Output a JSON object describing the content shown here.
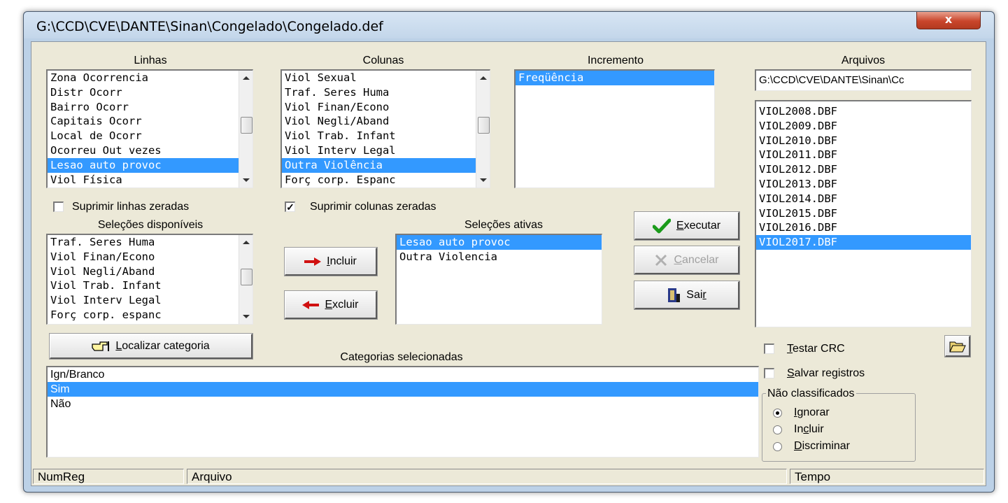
{
  "window": {
    "title": "G:\\CCD\\CVE\\DANTE\\Sinan\\Congelado\\Congelado.def",
    "close_label": "x"
  },
  "linhas": {
    "label": "Linhas",
    "items": [
      "Zona Ocorrencia",
      "Distr Ocorr",
      "Bairro Ocorr",
      "Capitais Ocorr",
      "Local de Ocorr",
      "Ocorreu Out vezes",
      "Lesao auto provoc",
      "Viol Física"
    ],
    "selected": "Lesao auto provoc"
  },
  "colunas": {
    "label": "Colunas",
    "items": [
      "Viol Sexual",
      "Traf. Seres Huma",
      "Viol Finan/Econo",
      "Viol Negli/Aband",
      "Viol Trab. Infant",
      "Viol Interv Legal",
      "Outra Violência",
      "Forç corp. Espanc"
    ],
    "selected": "Outra Violência"
  },
  "incremento": {
    "label": "Incremento",
    "items": [
      "Freqüência"
    ],
    "selected": "Freqüência"
  },
  "arquivos": {
    "label": "Arquivos",
    "path": "G:\\CCD\\CVE\\DANTE\\Sinan\\Cc",
    "items": [
      "VIOL2008.DBF",
      "VIOL2009.DBF",
      "VIOL2010.DBF",
      "VIOL2011.DBF",
      "VIOL2012.DBF",
      "VIOL2013.DBF",
      "VIOL2014.DBF",
      "VIOL2015.DBF",
      "VIOL2016.DBF",
      "VIOL2017.DBF"
    ],
    "selected": "VIOL2017.DBF"
  },
  "options": {
    "suprimir_linhas": {
      "label": "Suprimir linhas zeradas",
      "checked": false
    },
    "suprimir_colunas": {
      "label": "Suprimir colunas zeradas",
      "checked": true,
      "mark": "✓"
    }
  },
  "selecoes_disponiveis": {
    "label": "Seleções disponíveis",
    "items": [
      "Traf. Seres Huma",
      "Viol Finan/Econo",
      "Viol Negli/Aband",
      "Viol Trab. Infant",
      "Viol Interv Legal",
      "Forç corp. espanc"
    ]
  },
  "selecoes_ativas": {
    "label": "Seleções ativas",
    "items": [
      "Lesao auto provoc",
      "Outra Violencia"
    ],
    "selected": "Lesao auto provoc"
  },
  "buttons": {
    "incluir": {
      "pre": "",
      "accel": "I",
      "post": "ncluir"
    },
    "excluir": {
      "pre": "",
      "accel": "E",
      "post": "xcluir"
    },
    "executar": {
      "pre": "",
      "accel": "E",
      "post": "xecutar"
    },
    "cancelar": {
      "pre": "",
      "accel": "C",
      "post": "ancelar",
      "enabled": false
    },
    "sair": {
      "pre": "Sai",
      "accel": "r",
      "post": ""
    },
    "localizar": {
      "pre": "",
      "accel": "L",
      "post": "ocalizar categoria"
    }
  },
  "categorias": {
    "label": "Categorias selecionadas",
    "items": [
      "Ign/Branco",
      "Sim",
      "Não"
    ],
    "selected": "Sim"
  },
  "right_options": {
    "testar_crc": {
      "pre": "",
      "accel": "T",
      "post": "estar CRC",
      "checked": false
    },
    "salvar_registros": {
      "pre": "",
      "accel": "S",
      "post": "alvar registros",
      "checked": false
    }
  },
  "nao_classificados": {
    "label": "Não classificados",
    "options": [
      {
        "pre": "",
        "accel": "I",
        "post": "gnorar",
        "selected": true
      },
      {
        "pre": "In",
        "accel": "c",
        "post": "luir",
        "selected": false
      },
      {
        "pre": "",
        "accel": "D",
        "post": "iscriminar",
        "selected": false
      }
    ]
  },
  "status": {
    "numreg": "NumReg",
    "arquivo": "Arquivo",
    "tempo": "Tempo"
  },
  "colors": {
    "selection": "#3399ff",
    "face": "#ece9d8",
    "close": "#c9452b"
  },
  "icons": {
    "executar": "checkmark-icon",
    "incluir": "arrow-right-icon",
    "excluir": "arrow-left-icon",
    "cancelar": "cancel-icon",
    "sair": "door-exit-icon",
    "localizar": "pointing-hand-icon",
    "open_folder": "open-folder-icon"
  }
}
